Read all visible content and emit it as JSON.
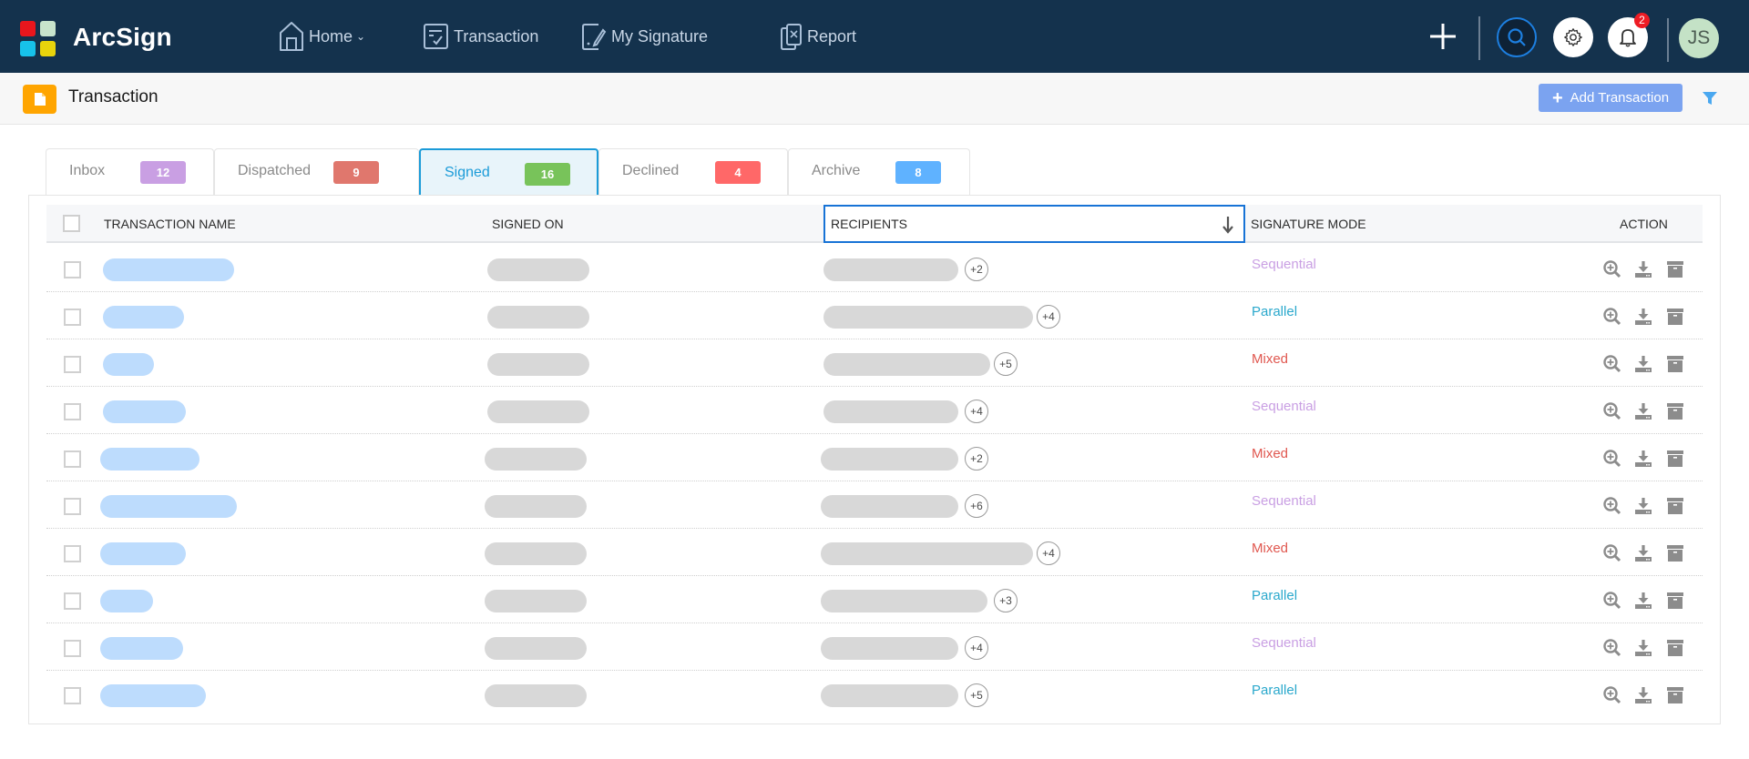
{
  "app": {
    "brand": "ArcSign"
  },
  "nav": {
    "items": [
      {
        "label": "Home",
        "icon": "home-icon",
        "has_dropdown": true
      },
      {
        "label": "Transaction",
        "icon": "checklist-icon"
      },
      {
        "label": "My Signature",
        "icon": "signature-icon"
      },
      {
        "label": "Report",
        "icon": "report-icon"
      }
    ],
    "notifications_count": "2",
    "avatar_initials": "JS"
  },
  "page": {
    "title": "Transaction",
    "add_button": "Add Transaction"
  },
  "tabs": [
    {
      "label": "Inbox",
      "count": "12",
      "color": "#c99fe3"
    },
    {
      "label": "Dispatched",
      "count": "9",
      "color": "#e0776d"
    },
    {
      "label": "Signed",
      "count": "16",
      "color": "#78c35a",
      "active": true
    },
    {
      "label": "Declined",
      "count": "4",
      "color": "#ff6868"
    },
    {
      "label": "Archive",
      "count": "8",
      "color": "#5fb2ff"
    }
  ],
  "table": {
    "columns": {
      "name": "TRANSACTION NAME",
      "signed_on": "SIGNED ON",
      "recipients": "RECIPIENTS",
      "mode": "SIGNATURE MODE",
      "action": "ACTION"
    },
    "sorted_column": "recipients",
    "sort_direction": "descending",
    "mode_colors": {
      "Sequential": "#c99fe3",
      "Parallel": "#2aa8cc",
      "Mixed": "#e0574f"
    },
    "rows": [
      {
        "recipients_more": "+2",
        "mode": "Sequential"
      },
      {
        "recipients_more": "+4",
        "mode": "Parallel"
      },
      {
        "recipients_more": "+5",
        "mode": "Mixed"
      },
      {
        "recipients_more": "+4",
        "mode": "Sequential"
      },
      {
        "recipients_more": "+2",
        "mode": "Mixed"
      },
      {
        "recipients_more": "+6",
        "mode": "Sequential"
      },
      {
        "recipients_more": "+4",
        "mode": "Mixed"
      },
      {
        "recipients_more": "+3",
        "mode": "Parallel"
      },
      {
        "recipients_more": "+4",
        "mode": "Sequential"
      },
      {
        "recipients_more": "+5",
        "mode": "Parallel"
      }
    ]
  }
}
